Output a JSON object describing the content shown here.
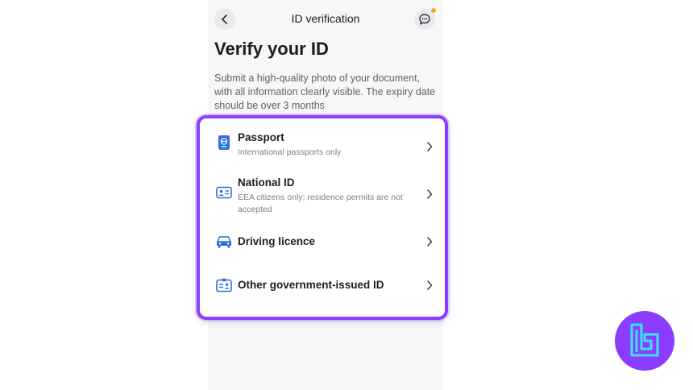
{
  "header": {
    "title": "ID verification"
  },
  "page": {
    "heading": "Verify your ID",
    "intro": "Submit a high-quality photo of your document, with all information clearly visible. The expiry date should be over 3 months"
  },
  "options": [
    {
      "title": "Passport",
      "subtitle": "International passports only",
      "icon": "passport-icon"
    },
    {
      "title": "National ID",
      "subtitle": "EEA citizens only; residence permits are not accepted",
      "icon": "id-card-icon"
    },
    {
      "title": "Driving licence",
      "subtitle": "",
      "icon": "car-icon"
    },
    {
      "title": "Other government-issued ID",
      "subtitle": "",
      "icon": "document-id-icon"
    }
  ],
  "colors": {
    "accent": "#8b3dff",
    "icon_blue": "#2f6fde",
    "notification": "#f5a623",
    "logo_glyph": "#39e6ff"
  }
}
